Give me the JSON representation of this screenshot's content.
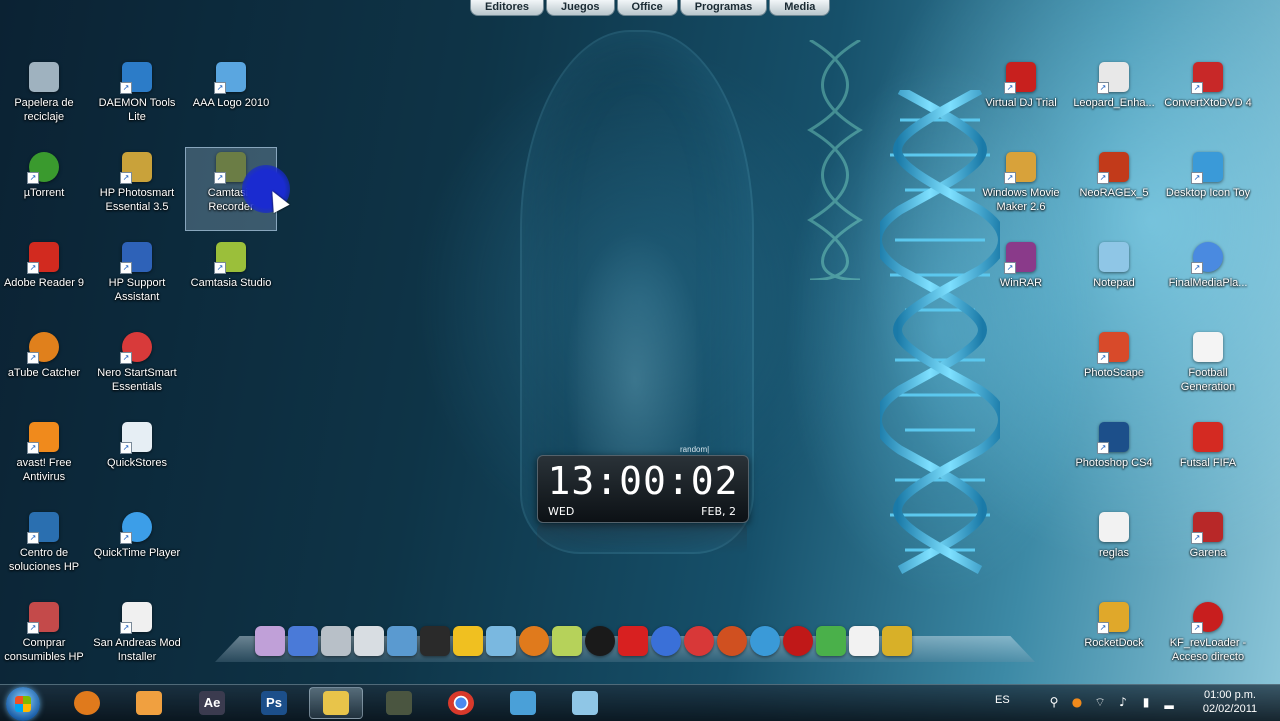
{
  "topbar": {
    "tabs": [
      "Editores",
      "Juegos",
      "Office",
      "Programas",
      "Media"
    ]
  },
  "desktop": {
    "left_icons": [
      {
        "label": "Papelera de reciclaje",
        "icon": "recycle-bin-icon",
        "color": "#9fb2bf"
      },
      {
        "label": "DAEMON Tools Lite",
        "icon": "daemon-tools-icon",
        "color": "#2c7cc8"
      },
      {
        "label": "AAA Logo 2010",
        "icon": "aaa-logo-icon",
        "color": "#5aa6e0"
      },
      {
        "label": "µTorrent",
        "icon": "utorrent-icon",
        "color": "#3a9a2e"
      },
      {
        "label": "HP Photosmart Essential 3.5",
        "icon": "hp-photosmart-icon",
        "color": "#c9a23a"
      },
      {
        "label": "Camtasia Recorder",
        "icon": "camtasia-recorder-icon",
        "color": "#6b7d45"
      },
      {
        "label": "Adobe Reader 9",
        "icon": "adobe-reader-icon",
        "color": "#d22a1f"
      },
      {
        "label": "HP Support Assistant",
        "icon": "hp-support-icon",
        "color": "#2e62b8"
      },
      {
        "label": "Camtasia Studio",
        "icon": "camtasia-studio-icon",
        "color": "#9bbf3a"
      },
      {
        "label": "aTube Catcher",
        "icon": "atube-catcher-icon",
        "color": "#e0801c"
      },
      {
        "label": "Nero StartSmart Essentials",
        "icon": "nero-icon",
        "color": "#d83a3a"
      },
      {
        "label": "avast! Free Antivirus",
        "icon": "avast-icon",
        "color": "#f08a1c"
      },
      {
        "label": "QuickStores",
        "icon": "quickstores-icon",
        "color": "#e6eef4"
      },
      {
        "label": "Centro de soluciones HP",
        "icon": "hp-solution-center-icon",
        "color": "#2a6fb0"
      },
      {
        "label": "QuickTime Player",
        "icon": "quicktime-icon",
        "color": "#3c9ee8"
      },
      {
        "label": "Comprar consumibles HP",
        "icon": "hp-supplies-icon",
        "color": "#c44a4a"
      },
      {
        "label": "San Andreas Mod Installer",
        "icon": "document-icon",
        "color": "#f0f0f0"
      }
    ],
    "right_icons": [
      {
        "label": "Virtual DJ Trial",
        "icon": "virtual-dj-icon",
        "color": "#c8201e"
      },
      {
        "label": "Leopard_Enha...",
        "icon": "leopard-icon",
        "color": "#e8e8e8"
      },
      {
        "label": "ConvertXtoDVD 4",
        "icon": "convertxtodvd-icon",
        "color": "#c82828"
      },
      {
        "label": "Windows Movie Maker 2.6",
        "icon": "movie-maker-icon",
        "color": "#d8a23a"
      },
      {
        "label": "NeoRAGEx_5",
        "icon": "neoragex-icon",
        "color": "#c23a1a"
      },
      {
        "label": "Desktop Icon Toy",
        "icon": "desktop-icon-toy-icon",
        "color": "#3a9ad8"
      },
      {
        "label": "WinRAR",
        "icon": "winrar-icon",
        "color": "#8a3a8a"
      },
      {
        "label": "Notepad",
        "icon": "notepad-icon",
        "color": "#8fc6e6"
      },
      {
        "label": "FinalMediaPla...",
        "icon": "final-media-player-icon",
        "color": "#4a8ae0"
      },
      {
        "label": "PhotoScape",
        "icon": "photoscape-icon",
        "color": "#d84a2a"
      },
      {
        "label": "Football Generation",
        "icon": "football-generation-icon",
        "color": "#f4f4f4"
      },
      {
        "label": "Photoshop CS4",
        "icon": "photoshop-icon",
        "color": "#1c4f8a"
      },
      {
        "label": "Futsal FIFA",
        "icon": "pdf-icon",
        "color": "#d42a22"
      },
      {
        "label": "reglas",
        "icon": "text-file-icon",
        "color": "#f2f2f2"
      },
      {
        "label": "Garena",
        "icon": "garena-icon",
        "color": "#b82828"
      },
      {
        "label": "RocketDock",
        "icon": "rocketdock-icon",
        "color": "#e0a82a"
      },
      {
        "label": "KF_revLoader - Acceso directo",
        "icon": "kf-revloader-icon",
        "color": "#c81e1e"
      }
    ]
  },
  "clock": {
    "brand": "random|",
    "time": "13:00:02",
    "day": "WED",
    "date": "FEB, 2"
  },
  "dock": {
    "items": [
      {
        "icon": "dock-itunes-icon",
        "color": "#c0a0d8"
      },
      {
        "icon": "dock-finder-icon",
        "color": "#4a7ad8"
      },
      {
        "icon": "dock-drive-icon",
        "color": "#b8c0c8"
      },
      {
        "icon": "dock-folder-icon",
        "color": "#d8dde2"
      },
      {
        "icon": "dock-image-icon",
        "color": "#5a9ad0"
      },
      {
        "icon": "dock-clapper-icon",
        "color": "#2a2a2a"
      },
      {
        "icon": "dock-download-icon",
        "color": "#f0c020"
      },
      {
        "icon": "dock-network-icon",
        "color": "#7ab8e0"
      },
      {
        "icon": "dock-atube-icon",
        "color": "#e07a1c"
      },
      {
        "icon": "dock-camtasia-icon",
        "color": "#b6d25a"
      },
      {
        "icon": "dock-hp-icon",
        "color": "#1a1a1a"
      },
      {
        "icon": "dock-convertx-icon",
        "color": "#d82020"
      },
      {
        "icon": "dock-media-player-icon",
        "color": "#3a70d8"
      },
      {
        "icon": "dock-nero-icon",
        "color": "#d83838"
      },
      {
        "icon": "dock-ares-icon",
        "color": "#d05020"
      },
      {
        "icon": "dock-quicktime-icon",
        "color": "#3a9ad8"
      },
      {
        "icon": "dock-6-icon",
        "color": "#c01818"
      },
      {
        "icon": "dock-messenger-icon",
        "color": "#4ab04a"
      },
      {
        "icon": "dock-document-icon",
        "color": "#f2f2f2"
      },
      {
        "icon": "dock-tools-icon",
        "color": "#d8b028"
      }
    ]
  },
  "taskbar": {
    "items": [
      {
        "icon": "atube-catcher-icon",
        "glyph": "",
        "color": "#e07a1c",
        "active": false
      },
      {
        "icon": "media-player-icon",
        "glyph": "",
        "color": "#f0a040",
        "active": false
      },
      {
        "icon": "after-effects-icon",
        "glyph": "Ae",
        "color": "#3b3b4f",
        "active": false
      },
      {
        "icon": "photoshop-icon",
        "glyph": "Ps",
        "color": "#1c4f8a",
        "active": false
      },
      {
        "icon": "folder-icon",
        "glyph": "",
        "color": "#e8c44a",
        "active": true
      },
      {
        "icon": "camtasia-recorder-icon",
        "glyph": "",
        "color": "#4a5540",
        "active": false
      },
      {
        "icon": "chrome-icon",
        "glyph": "",
        "color": "#d8392b",
        "active": false
      },
      {
        "icon": "messenger-icon",
        "glyph": "",
        "color": "#4aa0d8",
        "active": false
      },
      {
        "icon": "notepad-icon",
        "glyph": "",
        "color": "#8fc6e6",
        "active": false
      }
    ],
    "language": "ES",
    "time": "01:00 p.m.",
    "date": "02/02/2011"
  }
}
